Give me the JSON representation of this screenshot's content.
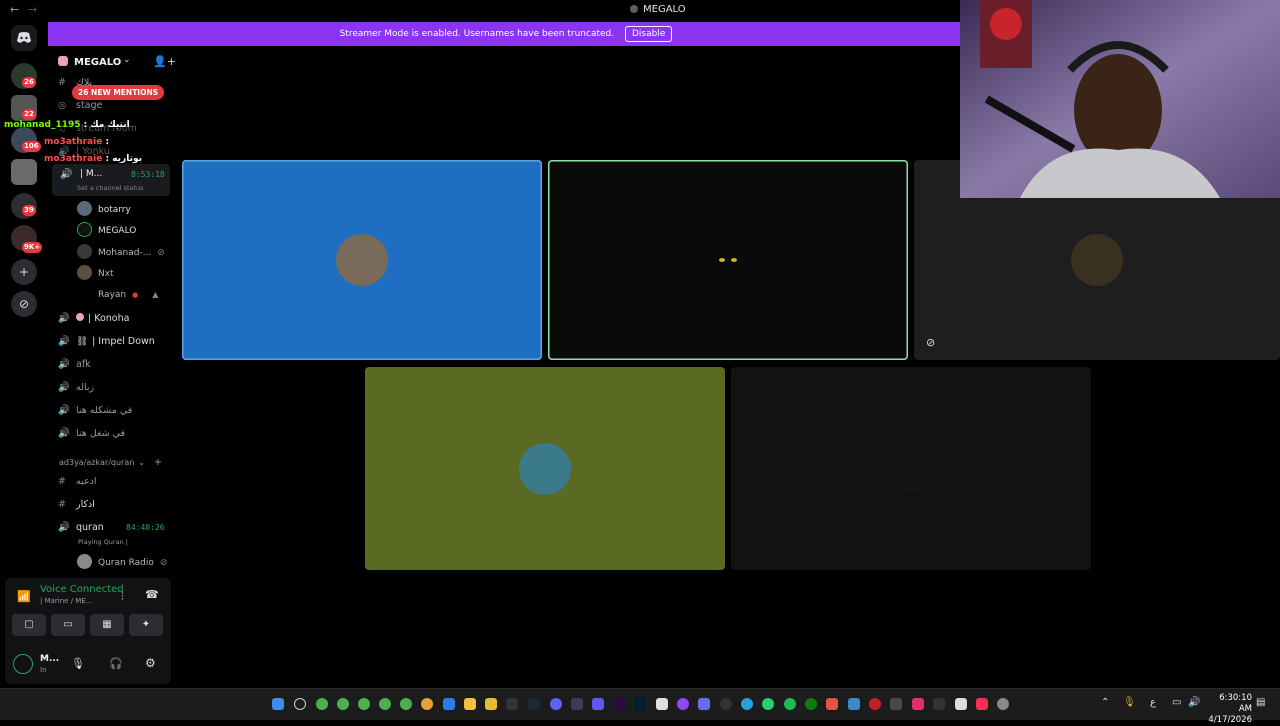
{
  "titlebar": {
    "back": "←",
    "forward": "→",
    "title": "MEGALO"
  },
  "banner": {
    "message": "Streamer Mode is enabled. Usernames have been truncated.",
    "button": "Disable"
  },
  "guilds": {
    "discord_icon": "discord-logo-icon",
    "badges": [
      "26",
      "22",
      "106",
      "39",
      "9K+"
    ],
    "add_icon": "+",
    "explore_icon": "⊘"
  },
  "server": {
    "name": "MEGALO",
    "chevron": "⌄",
    "invite_icon": "👤+"
  },
  "channels": {
    "top": [
      {
        "icon": "#",
        "label": "بلاك"
      },
      {
        "icon": "◎",
        "label": "stage"
      },
      {
        "icon": "♫",
        "label": "stream room"
      },
      {
        "icon": "🔊",
        "label": "| Yonku"
      }
    ],
    "mentions": "26 NEW MENTIONS",
    "active_channel": {
      "label": "| M...",
      "time": "8:53:18",
      "status": "Set a channel status"
    },
    "members": [
      {
        "name": "botarry"
      },
      {
        "name": "MEGALO"
      },
      {
        "name": "Mohanad-..."
      },
      {
        "name": "Nxt"
      },
      {
        "name": "Rayan"
      }
    ],
    "voice": [
      {
        "label": "| Konoha"
      },
      {
        "label": "| Impel Down"
      },
      {
        "label": "afk"
      },
      {
        "label": "زباله"
      },
      {
        "label": "في مشكله هنا"
      },
      {
        "label": "في شغل هنا"
      }
    ],
    "category": "ad3ya/azkar/quran",
    "category_add": "+",
    "cat_channels": [
      {
        "icon": "#",
        "label": "ادعيه"
      },
      {
        "icon": "#",
        "label": "اذكار"
      }
    ],
    "quran": {
      "label": "quran",
      "time": "84:40:26",
      "playing": "Playing Quran |",
      "member": "Quran Radio"
    }
  },
  "chat_overlay": [
    {
      "user": "mohanad_1195",
      "text": ": انتيك مك",
      "color": "#7CFC00"
    },
    {
      "user": "mo3athraie",
      "text": ":",
      "color": "#ff4d4d"
    },
    {
      "user": "mo3athraie",
      "text": ": بوتاريه",
      "color": "#ff4d4d"
    }
  ],
  "userpanel": {
    "voice_connected": "Voice Connected",
    "voice_sub": "| Marine / ME...",
    "username": "M...",
    "user_status": "In"
  },
  "tiles": [
    {
      "bg": "#1e6fc2",
      "border": "#5ea3e6",
      "avatar_icon": "person-avatar"
    },
    {
      "bg": "#0a0a0a",
      "border": "#8fe0a8",
      "avatar_icon": "black-cat-avatar"
    },
    {
      "bg": "#1e1e1e",
      "border": "",
      "avatar_icon": "soccer-player-avatar",
      "muted_icon": "mic-off-icon"
    },
    {
      "bg": "#5a6a22",
      "border": "",
      "avatar_icon": "cowboy-avatar"
    },
    {
      "bg": "#121212",
      "border": "",
      "avatar_icon": "shadow-figure-avatar"
    }
  ],
  "taskbar": {
    "clock_time": "6:30:10 AM",
    "clock_date": "4/17/2026",
    "lang": "ع"
  }
}
